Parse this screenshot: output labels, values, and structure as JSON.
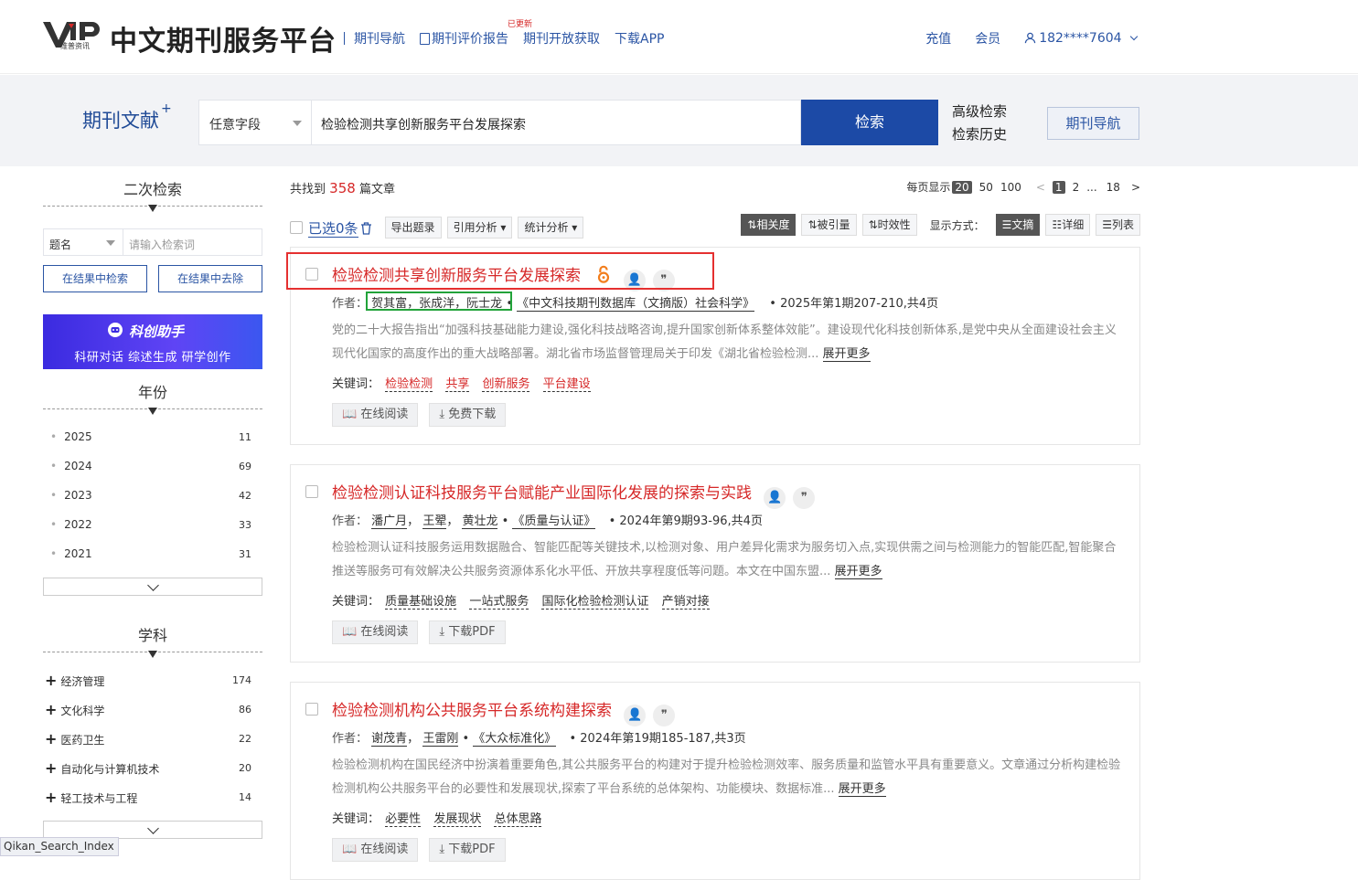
{
  "header": {
    "logo_text": "VIP",
    "logo_sub": "维普资讯",
    "site_title": "中文期刊服务平台",
    "nav": [
      "期刊导航",
      "期刊评价报告",
      "期刊开放获取",
      "下载APP"
    ],
    "new_tag": "已更新",
    "recharge": "充值",
    "member": "会员",
    "user": "182****7604"
  },
  "search": {
    "section_title": "期刊文献",
    "section_sup": "+",
    "field": "任意字段",
    "query": "检验检测共享创新服务平台发展探索",
    "button": "检索",
    "advanced": "高级检索",
    "history": "检索历史",
    "journal_nav": "期刊导航"
  },
  "sidebar": {
    "secondary_title": "二次检索",
    "sub_field": "题名",
    "sub_placeholder": "请输入检索词",
    "within_btn": "在结果中检索",
    "exclude_btn": "在结果中去除",
    "banner_title": "科创助手",
    "banner_sub": "科研对话   综述生成   研学创作",
    "year_title": "年份",
    "years": [
      {
        "label": "2025",
        "count": "11"
      },
      {
        "label": "2024",
        "count": "69"
      },
      {
        "label": "2023",
        "count": "42"
      },
      {
        "label": "2022",
        "count": "33"
      },
      {
        "label": "2021",
        "count": "31"
      }
    ],
    "subject_title": "学科",
    "subjects": [
      {
        "label": "经济管理",
        "count": "174"
      },
      {
        "label": "文化科学",
        "count": "86"
      },
      {
        "label": "医药卫生",
        "count": "22"
      },
      {
        "label": "自动化与计算机技术",
        "count": "20"
      },
      {
        "label": "轻工技术与工程",
        "count": "14"
      }
    ]
  },
  "results": {
    "found_prefix": "共找到",
    "found_count": "358",
    "found_suffix": "篇文章",
    "per_page_label": "每页显示",
    "per_page_options": [
      "20",
      "50",
      "100"
    ],
    "pages": [
      "<",
      "1",
      "2",
      "...",
      "18",
      ">"
    ],
    "selected": "已选0条",
    "export": "导出题录",
    "cite_analysis": "引用分析",
    "stat_analysis": "统计分析",
    "sort_relevance": "相关度",
    "sort_cited": "被引量",
    "sort_time": "时效性",
    "display_label": "显示方式：",
    "view_abstract": "文摘",
    "view_detail": "详细",
    "view_list": "列表",
    "author_label": "作者：",
    "keyword_label": "关键词：",
    "more": "展开更多",
    "read_online": "在线阅读",
    "free_download": "免费下载",
    "download_pdf": "下载PDF",
    "items": [
      {
        "title": "检验检测共享创新服务平台发展探索",
        "authors": "贺其富，张成洋，阮士龙",
        "journal": "《中文科技期刊数据库（文摘版）社会科学》",
        "issue": "2025年第1期207-210,共4页",
        "abstract": "党的二十大报告指出“加强科技基础能力建设,强化科技战略咨询,提升国家创新体系整体效能”。建设现代化科技创新体系,是党中央从全面建设社会主义现代化国家的高度作出的重大战略部署。湖北省市场监督管理局关于印发《湖北省检验检测...",
        "keywords": [
          "检验检测",
          "共享",
          "创新服务",
          "平台建设"
        ]
      },
      {
        "title": "检验检测认证科技服务平台赋能产业国际化发展的探索与实践",
        "authors": [
          "潘广月",
          "王翚",
          "黄壮龙"
        ],
        "journal": "《质量与认证》",
        "issue": "2024年第9期93-96,共4页",
        "abstract": "检验检测认证科技服务运用数据融合、智能匹配等关键技术,以检测对象、用户差异化需求为服务切入点,实现供需之间与检测能力的智能匹配,智能聚合推送等服务可有效解决公共服务资源体系化水平低、开放共享程度低等问题。本文在中国东盟...",
        "keywords": [
          "质量基础设施",
          "一站式服务",
          "国际化检验检测认证",
          "产销对接"
        ]
      },
      {
        "title": "检验检测机构公共服务平台系统构建探索",
        "authors": [
          "谢茂青",
          "王雷刚"
        ],
        "journal": "《大众标准化》",
        "issue": "2024年第19期185-187,共3页",
        "abstract": "检验检测机构在国民经济中扮演着重要角色,其公共服务平台的构建对于提升检验检测效率、服务质量和监管水平具有重要意义。文章通过分析构建检验检测机构公共服务平台的必要性和发展现状,探索了平台系统的总体架构、功能模块、数据标准...",
        "keywords": [
          "必要性",
          "发展现状",
          "总体思路"
        ]
      }
    ]
  },
  "status_tag": "Qikan_Search_Index",
  "colors": {
    "primary": "#1c4aa6",
    "link": "#2b55a4",
    "highlight": "#d62828",
    "red_box": "#e53030",
    "green_box": "#22a33a"
  }
}
